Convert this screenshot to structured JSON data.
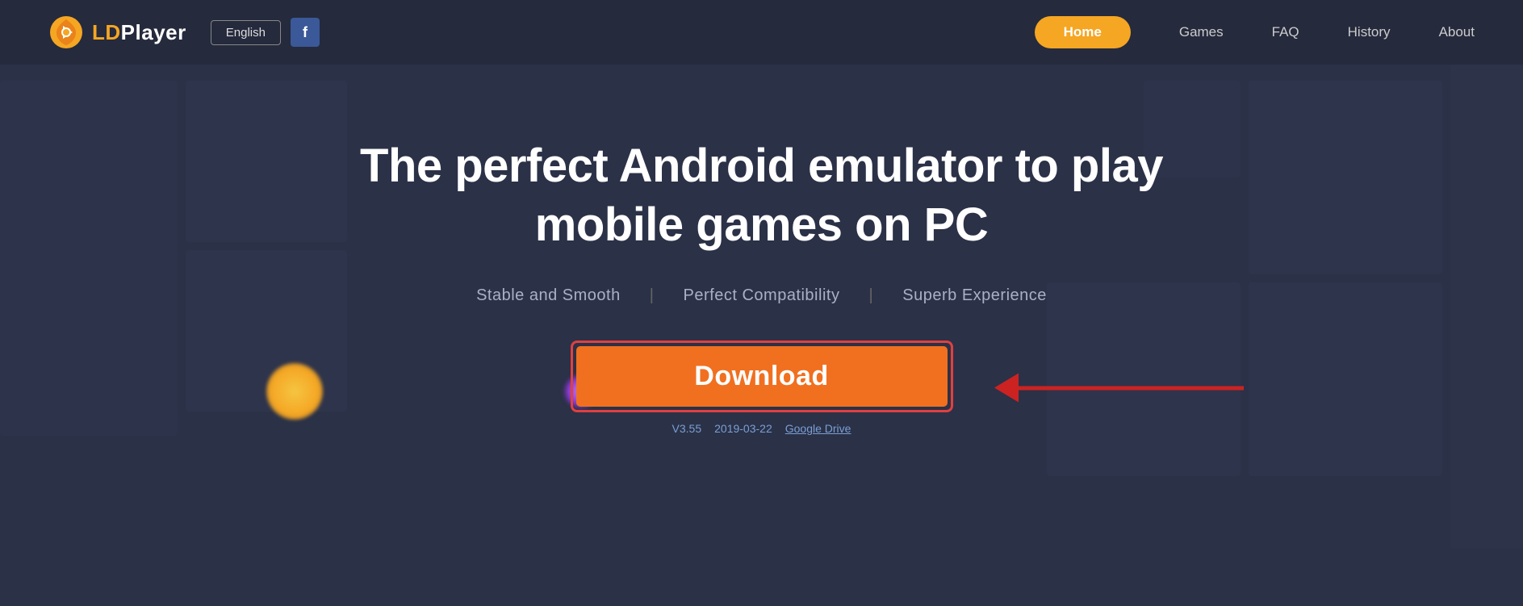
{
  "logo": {
    "icon_alt": "ldplayer-logo",
    "name_prefix": "LD",
    "name_suffix": "Player"
  },
  "navbar": {
    "lang_button": "English",
    "facebook_letter": "f",
    "home_label": "Home",
    "games_label": "Games",
    "faq_label": "FAQ",
    "history_label": "History",
    "about_label": "About"
  },
  "hero": {
    "headline": "The perfect Android emulator to play mobile games on PC",
    "subline_1": "Stable and Smooth",
    "subline_sep1": "|",
    "subline_2": "Perfect Compatibility",
    "subline_sep2": "|",
    "subline_3": "Superb Experience",
    "download_button": "Download",
    "version": "V3.55",
    "date": "2019-03-22",
    "google_drive": "Google Drive"
  },
  "colors": {
    "accent_orange": "#f5a623",
    "download_bg": "#f07020",
    "highlight_red": "#cc2222",
    "bg_dark": "#2b3147",
    "navbar_bg": "#252a3d"
  }
}
